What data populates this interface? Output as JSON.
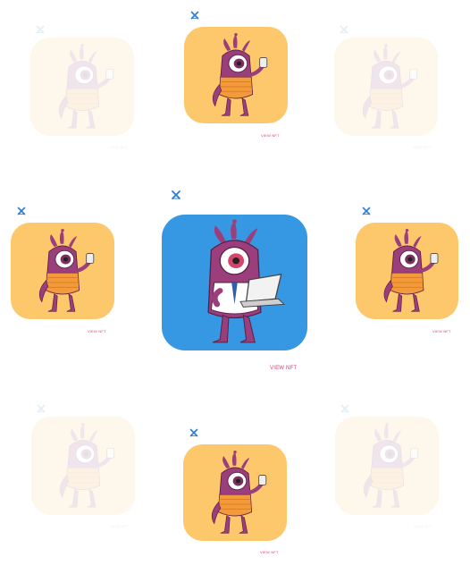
{
  "colors": {
    "tile_orange": "#fdc76b",
    "tile_blue": "#3697e2",
    "monster_body": "#9b3f7c",
    "link_pink": "#d6436e",
    "badge_blue": "#2f7fd6"
  },
  "icons": {
    "badge": "x-logo-icon",
    "monster": "purple-cyclops-monster-icon"
  },
  "cards": [
    {
      "id": "top-left",
      "link": "VIEW NFT"
    },
    {
      "id": "top-center",
      "link": "VIEW NFT"
    },
    {
      "id": "top-right",
      "link": "VIEW NFT"
    },
    {
      "id": "middle-left",
      "link": "VIEW NFT"
    },
    {
      "id": "middle-center",
      "link": "VIEW NFT"
    },
    {
      "id": "middle-right",
      "link": "VIEW NFT"
    },
    {
      "id": "bottom-left",
      "link": "VIEW NFT"
    },
    {
      "id": "bottom-center",
      "link": "VIEW NFT"
    },
    {
      "id": "bottom-right",
      "link": "VIEW NFT"
    }
  ]
}
